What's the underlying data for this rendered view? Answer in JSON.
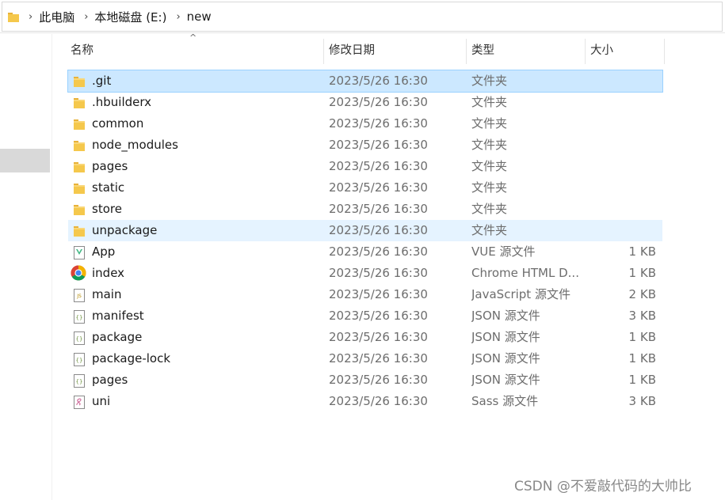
{
  "breadcrumb": [
    "此电脑",
    "本地磁盘 (E:)",
    "new"
  ],
  "columns": {
    "name": "名称",
    "date": "修改日期",
    "type": "类型",
    "size": "大小"
  },
  "files": [
    {
      "name": ".git",
      "date": "2023/5/26 16:30",
      "type": "文件夹",
      "size": "",
      "icon": "folder-icon",
      "state": "selected"
    },
    {
      "name": ".hbuilderx",
      "date": "2023/5/26 16:30",
      "type": "文件夹",
      "size": "",
      "icon": "folder-icon",
      "state": ""
    },
    {
      "name": "common",
      "date": "2023/5/26 16:30",
      "type": "文件夹",
      "size": "",
      "icon": "folder-icon",
      "state": ""
    },
    {
      "name": "node_modules",
      "date": "2023/5/26 16:30",
      "type": "文件夹",
      "size": "",
      "icon": "folder-icon",
      "state": ""
    },
    {
      "name": "pages",
      "date": "2023/5/26 16:30",
      "type": "文件夹",
      "size": "",
      "icon": "folder-icon",
      "state": ""
    },
    {
      "name": "static",
      "date": "2023/5/26 16:30",
      "type": "文件夹",
      "size": "",
      "icon": "folder-icon",
      "state": ""
    },
    {
      "name": "store",
      "date": "2023/5/26 16:30",
      "type": "文件夹",
      "size": "",
      "icon": "folder-icon",
      "state": ""
    },
    {
      "name": "unpackage",
      "date": "2023/5/26 16:30",
      "type": "文件夹",
      "size": "",
      "icon": "folder-icon",
      "state": "hover"
    },
    {
      "name": "App",
      "date": "2023/5/26 16:30",
      "type": "VUE 源文件",
      "size": "1 KB",
      "icon": "vue-file-icon",
      "state": ""
    },
    {
      "name": "index",
      "date": "2023/5/26 16:30",
      "type": "Chrome HTML D...",
      "size": "1 KB",
      "icon": "chrome-icon",
      "state": ""
    },
    {
      "name": "main",
      "date": "2023/5/26 16:30",
      "type": "JavaScript 源文件",
      "size": "2 KB",
      "icon": "js-file-icon",
      "state": ""
    },
    {
      "name": "manifest",
      "date": "2023/5/26 16:30",
      "type": "JSON 源文件",
      "size": "3 KB",
      "icon": "json-file-icon",
      "state": ""
    },
    {
      "name": "package",
      "date": "2023/5/26 16:30",
      "type": "JSON 源文件",
      "size": "1 KB",
      "icon": "json-file-icon",
      "state": ""
    },
    {
      "name": "package-lock",
      "date": "2023/5/26 16:30",
      "type": "JSON 源文件",
      "size": "1 KB",
      "icon": "json-file-icon",
      "state": ""
    },
    {
      "name": "pages",
      "date": "2023/5/26 16:30",
      "type": "JSON 源文件",
      "size": "1 KB",
      "icon": "json-file-icon",
      "state": ""
    },
    {
      "name": "uni",
      "date": "2023/5/26 16:30",
      "type": "Sass 源文件",
      "size": "3 KB",
      "icon": "sass-file-icon",
      "state": ""
    }
  ],
  "watermark": "CSDN @不爱敲代码的大帅比",
  "colors": {
    "selected": "#cce8ff",
    "hover": "#e5f3ff",
    "folder": "#f5c84c"
  }
}
